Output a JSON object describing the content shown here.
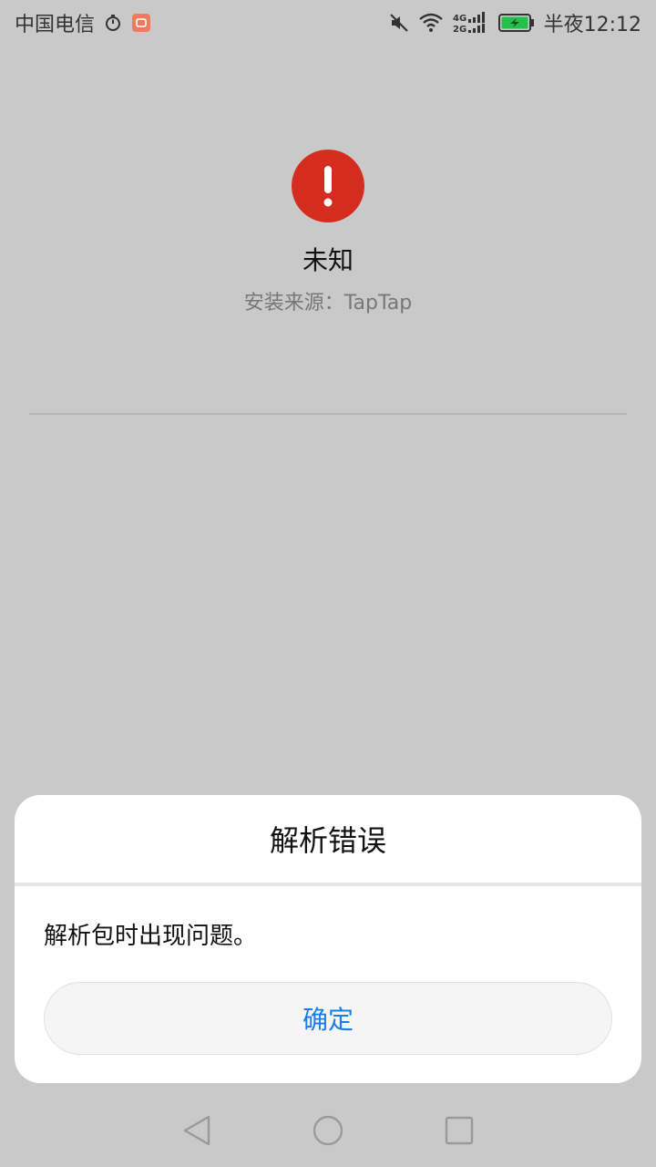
{
  "status_bar": {
    "carrier": "中国电信",
    "network": "4G\n2G",
    "time": "半夜12:12",
    "icons": [
      "stopwatch-icon",
      "notification-app-icon",
      "mute-icon",
      "wifi-icon",
      "signal-icon",
      "battery-charging-icon"
    ],
    "battery_color": "#22c24a"
  },
  "app": {
    "name": "未知",
    "source": "安装来源：TapTap",
    "alert_color": "#d42d1f"
  },
  "dialog": {
    "title": "解析错误",
    "message": "解析包时出现问题。",
    "confirm_label": "确定",
    "accent": "#1a7ee8"
  },
  "nav": {
    "icons": [
      "back-icon",
      "home-icon",
      "recents-icon"
    ]
  }
}
